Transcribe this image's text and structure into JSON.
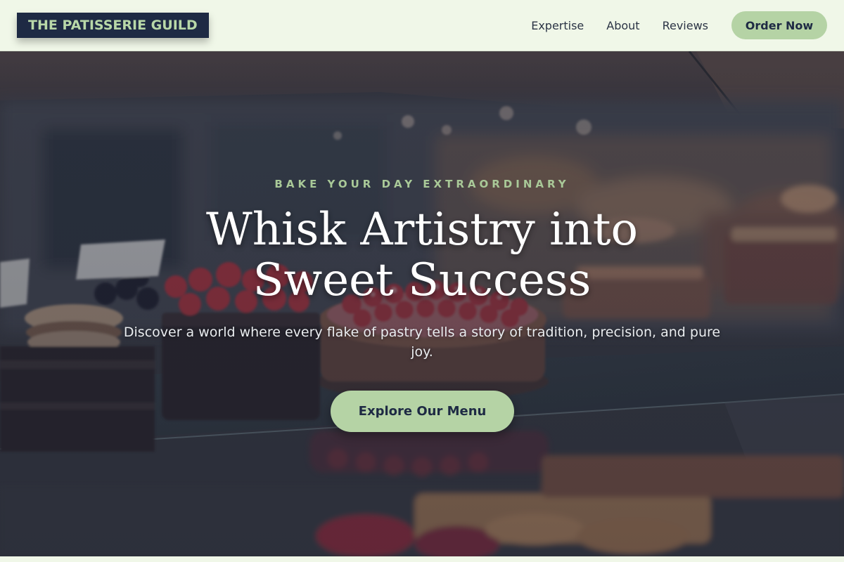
{
  "brand": {
    "name": "THE PATISSERIE GUILD"
  },
  "nav": {
    "links": [
      {
        "label": "Expertise"
      },
      {
        "label": "About"
      },
      {
        "label": "Reviews"
      }
    ],
    "cta_label": "Order Now"
  },
  "hero": {
    "eyebrow": "BAKE YOUR DAY EXTRAORDINARY",
    "title": "Whisk Artistry into Sweet Success",
    "description": "Discover a world where every flake of pastry tells a story of tradition, precision, and pure joy.",
    "cta_label": "Explore Our Menu",
    "background_image": "pastry-display-case-photo"
  },
  "colors": {
    "accent": "#b5d3a5",
    "navy": "#1e2a44",
    "page_bg": "#f0f7e8",
    "eyebrow": "#a9c998"
  }
}
